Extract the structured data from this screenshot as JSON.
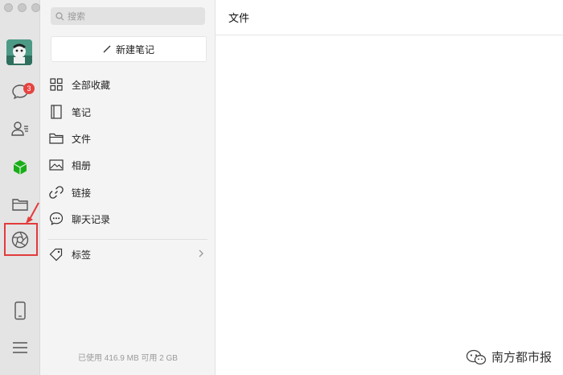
{
  "sidebar_rail": {
    "chat_badge": "3"
  },
  "panel": {
    "search_placeholder": "搜索",
    "new_note_label": "新建笔记",
    "items": [
      {
        "label": "全部收藏",
        "icon": "grid-icon"
      },
      {
        "label": "笔记",
        "icon": "notebook-icon"
      },
      {
        "label": "文件",
        "icon": "folder-icon"
      },
      {
        "label": "相册",
        "icon": "image-icon"
      },
      {
        "label": "链接",
        "icon": "link-icon"
      },
      {
        "label": "聊天记录",
        "icon": "chat-history-icon"
      }
    ],
    "tags_label": "标签",
    "storage_text": "已使用 416.9 MB 可用 2 GB"
  },
  "main": {
    "title": "文件"
  },
  "watermark": {
    "text": "南方都市报"
  },
  "colors": {
    "badge": "#e64340",
    "highlight_box": "#e23b3b",
    "green_app": "#1aad19"
  }
}
